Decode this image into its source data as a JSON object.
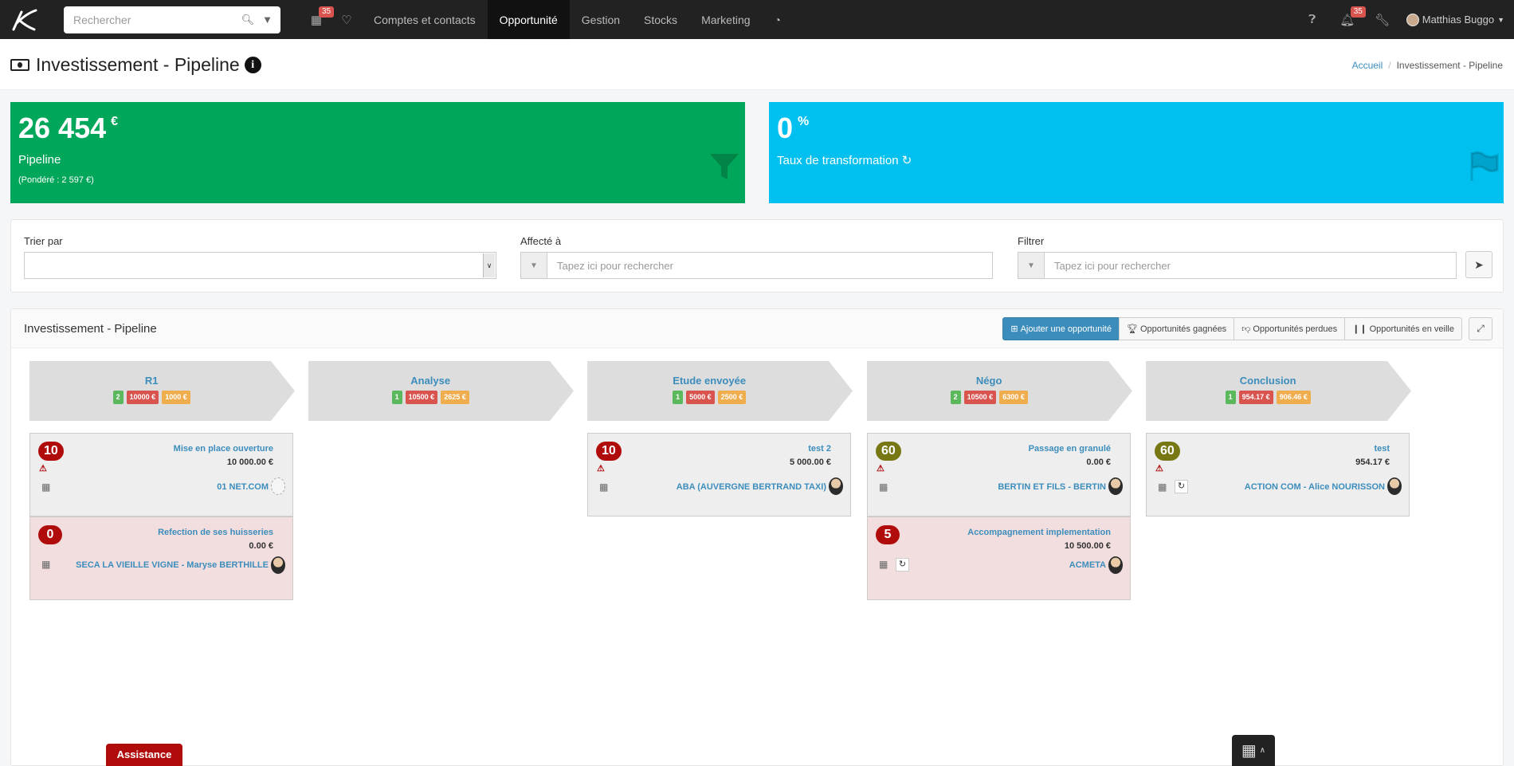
{
  "nav": {
    "search_placeholder": "Rechercher",
    "calendar_badge": "35",
    "notif_badge": "35",
    "menu": [
      "Comptes et contacts",
      "Opportunité",
      "Gestion",
      "Stocks",
      "Marketing"
    ],
    "active_menu": "Opportunité",
    "user_name": "Matthias Buggo"
  },
  "page": {
    "title": "Investissement - Pipeline",
    "breadcrumb_home": "Accueil",
    "breadcrumb_current": "Investissement - Pipeline"
  },
  "stats": {
    "pipeline_value": "26 454",
    "pipeline_unit": "€",
    "pipeline_label": "Pipeline",
    "pipeline_weighted": "(Pondéré : 2 597 €)",
    "transform_value": "0",
    "transform_unit": "%",
    "transform_label": "Taux de transformation",
    "colors": {
      "green": "#00a65a",
      "blue": "#00c0ef"
    }
  },
  "filters": {
    "sort_label": "Trier par",
    "sort_value": "",
    "assigned_label": "Affecté à",
    "assigned_placeholder": "Tapez ici pour rechercher",
    "filter_label": "Filtrer",
    "filter_placeholder": "Tapez ici pour rechercher"
  },
  "pipeline": {
    "title": "Investissement - Pipeline",
    "buttons": {
      "add": "Ajouter une opportunité",
      "won": "Opportunités gagnées",
      "lost": "Opportunités perdues",
      "watch": "Opportunités en veille"
    },
    "stages": [
      {
        "name": "R1",
        "count": "2",
        "total": "10000 €",
        "weighted": "1000 €"
      },
      {
        "name": "Analyse",
        "count": "1",
        "total": "10500 €",
        "weighted": "2625 €"
      },
      {
        "name": "Etude envoyée",
        "count": "1",
        "total": "5000 €",
        "weighted": "2500 €"
      },
      {
        "name": "Négo",
        "count": "2",
        "total": "10500 €",
        "weighted": "6300 €"
      },
      {
        "name": "Conclusion",
        "count": "1",
        "total": "954.17 €",
        "weighted": "906.46 €"
      }
    ],
    "cards": [
      {
        "score": "10",
        "title": "Mise en place ouverture",
        "amount": "10 000.00 €",
        "company": "01 NET.COM",
        "style": "grey",
        "score_color": "red"
      },
      {
        "score": "0",
        "title": "Refection de ses huisseries",
        "amount": "0.00 €",
        "company": "SECA LA VIEILLE VIGNE - Maryse BERTHILLE",
        "style": "pink",
        "score_color": "red"
      },
      {
        "score": "10",
        "title": "test 2",
        "amount": "5 000.00 €",
        "company": "ABA (AUVERGNE BERTRAND TAXI)",
        "style": "grey",
        "score_color": "red"
      },
      {
        "score": "60",
        "title": "Passage en granulé",
        "amount": "0.00 €",
        "company": "BERTIN ET FILS - BERTIN",
        "style": "grey",
        "score_color": "olive"
      },
      {
        "score": "5",
        "title": "Accompagnement implementation",
        "amount": "10 500.00 €",
        "company": "ACMETA",
        "style": "pink",
        "score_color": "red"
      },
      {
        "score": "60",
        "title": "test",
        "amount": "954.17 €",
        "company": "ACTION COM - Alice NOURISSON",
        "style": "grey",
        "score_color": "olive"
      }
    ]
  },
  "footer": {
    "assistance": "Assistance"
  }
}
